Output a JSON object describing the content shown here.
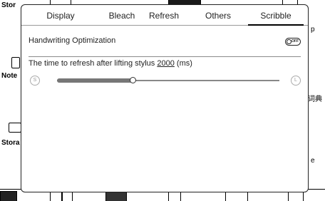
{
  "background": {
    "labels": {
      "store": "Stor",
      "notes": "Note",
      "storage": "Stora",
      "right_p": "p",
      "right_dict": "词典",
      "right_e": "e"
    }
  },
  "dialog": {
    "tabs": [
      {
        "label": "Display"
      },
      {
        "label": "Bleach"
      },
      {
        "label": "Refresh"
      },
      {
        "label": "Others"
      },
      {
        "label": "Scribble"
      }
    ],
    "active_tab": "Scribble",
    "handwriting_optimization": {
      "label": "Handwriting Optimization",
      "toggle_text": "OFF",
      "enabled": false
    },
    "refresh_time": {
      "prefix": "The time to refresh after lifting stylus",
      "value": "2000",
      "unit": "(ms)",
      "slider_fraction": 0.34,
      "min_label": "S",
      "max_label": "L"
    }
  },
  "colors": {
    "text": "#222222",
    "border": "#222222",
    "divider": "#8a8a8a"
  }
}
